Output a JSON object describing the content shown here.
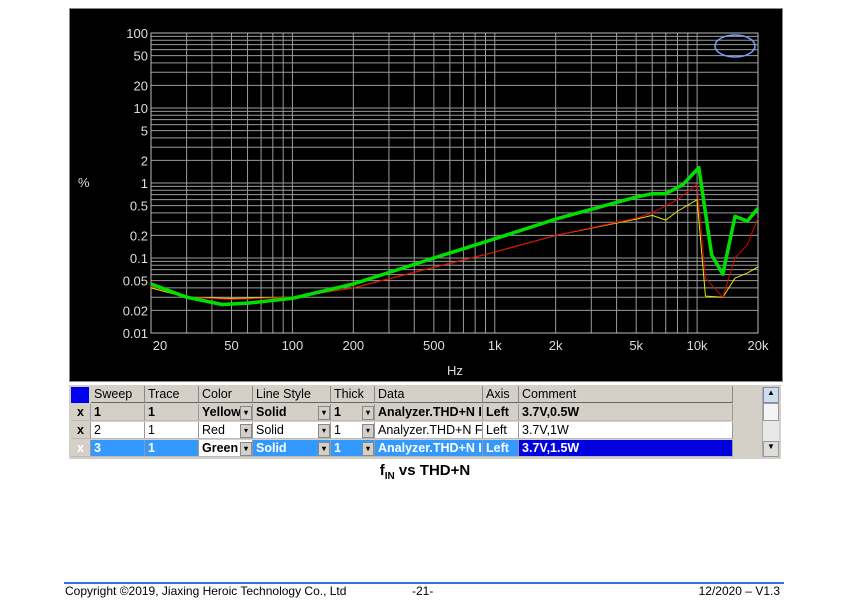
{
  "chart_data": {
    "type": "line",
    "title": "",
    "xlabel": "Hz",
    "ylabel": "%",
    "xscale": "log",
    "yscale": "log",
    "xlim": [
      20,
      20000
    ],
    "ylim": [
      0.01,
      100
    ],
    "x_ticks": [
      {
        "v": 20,
        "l": "20"
      },
      {
        "v": 50,
        "l": "50"
      },
      {
        "v": 100,
        "l": "100"
      },
      {
        "v": 200,
        "l": "200"
      },
      {
        "v": 500,
        "l": "500"
      },
      {
        "v": 1000,
        "l": "1k"
      },
      {
        "v": 2000,
        "l": "2k"
      },
      {
        "v": 5000,
        "l": "5k"
      },
      {
        "v": 10000,
        "l": "10k"
      },
      {
        "v": 20000,
        "l": "20k"
      }
    ],
    "y_ticks": [
      {
        "v": 100,
        "l": "100"
      },
      {
        "v": 50,
        "l": "50"
      },
      {
        "v": 20,
        "l": "20"
      },
      {
        "v": 10,
        "l": "10"
      },
      {
        "v": 5,
        "l": "5"
      },
      {
        "v": 2,
        "l": "2"
      },
      {
        "v": 1,
        "l": "1"
      },
      {
        "v": 0.5,
        "l": "0.5"
      },
      {
        "v": 0.2,
        "l": "0.2"
      },
      {
        "v": 0.1,
        "l": "0.1"
      },
      {
        "v": 0.05,
        "l": "0.05"
      },
      {
        "v": 0.02,
        "l": "0.02"
      },
      {
        "v": 0.01,
        "l": "0.01"
      }
    ],
    "grid": true,
    "series": [
      {
        "color": "#e6e600",
        "width": 1,
        "points": [
          [
            20,
            0.04
          ],
          [
            30,
            0.03
          ],
          [
            50,
            0.029
          ],
          [
            100,
            0.03
          ],
          [
            200,
            0.04
          ],
          [
            500,
            0.075
          ],
          [
            1000,
            0.12
          ],
          [
            2000,
            0.2
          ],
          [
            5000,
            0.33
          ],
          [
            6000,
            0.37
          ],
          [
            7000,
            0.32
          ],
          [
            8000,
            0.42
          ],
          [
            10000,
            0.6
          ],
          [
            11000,
            0.031
          ],
          [
            13400,
            0.03
          ],
          [
            15400,
            0.054
          ],
          [
            17700,
            0.063
          ],
          [
            20000,
            0.076
          ]
        ]
      },
      {
        "color": "#e00000",
        "width": 1,
        "points": [
          [
            20,
            0.042
          ],
          [
            30,
            0.03
          ],
          [
            50,
            0.028
          ],
          [
            100,
            0.03
          ],
          [
            200,
            0.04
          ],
          [
            500,
            0.075
          ],
          [
            1000,
            0.12
          ],
          [
            2000,
            0.2
          ],
          [
            5000,
            0.34
          ],
          [
            6000,
            0.4
          ],
          [
            8000,
            0.6
          ],
          [
            10000,
            0.97
          ],
          [
            11000,
            0.054
          ],
          [
            13400,
            0.03
          ],
          [
            15400,
            0.1
          ],
          [
            17700,
            0.15
          ],
          [
            20000,
            0.34
          ]
        ]
      },
      {
        "color": "#00e000",
        "width": 3.5,
        "points": [
          [
            20,
            0.045
          ],
          [
            30,
            0.03
          ],
          [
            45,
            0.024
          ],
          [
            60,
            0.025
          ],
          [
            100,
            0.029
          ],
          [
            200,
            0.045
          ],
          [
            500,
            0.1
          ],
          [
            1000,
            0.18
          ],
          [
            2000,
            0.33
          ],
          [
            5000,
            0.65
          ],
          [
            6000,
            0.72
          ],
          [
            7000,
            0.72
          ],
          [
            8500,
            0.95
          ],
          [
            10200,
            1.6
          ],
          [
            11800,
            0.11
          ],
          [
            13400,
            0.061
          ],
          [
            15400,
            0.36
          ],
          [
            17700,
            0.31
          ],
          [
            20000,
            0.46
          ]
        ]
      }
    ]
  },
  "logo": "Ap",
  "table": {
    "headers": [
      "Sweep",
      "Trace",
      "Color",
      "Line Style",
      "Thick",
      "Data",
      "Axis",
      "Comment"
    ],
    "rows": [
      {
        "check": "x",
        "sweep": "1",
        "trace": "1",
        "color": "Yellow",
        "style": "Solid",
        "thick": "1",
        "data": "Analyzer.THD+N I",
        "axis": "Left",
        "comment": "3.7V,0.5W"
      },
      {
        "check": "x",
        "sweep": "2",
        "trace": "1",
        "color": "Red",
        "style": "Solid",
        "thick": "1",
        "data": "Analyzer.THD+N F",
        "axis": "Left",
        "comment": "3.7V,1W"
      },
      {
        "check": "x",
        "sweep": "3",
        "trace": "1",
        "color": "Green",
        "style": "Solid",
        "thick": "1",
        "data": "Analyzer.THD+N I",
        "axis": "Left",
        "comment": "3.7V,1.5W"
      }
    ]
  },
  "caption": {
    "f": "f",
    "sub": "IN",
    "rest": " vs THD+N"
  },
  "footer": {
    "copyright": "Copyright ©2019, Jiaxing Heroic Technology Co., Ltd",
    "page": "-21-",
    "version": "12/2020 – V1.3"
  }
}
